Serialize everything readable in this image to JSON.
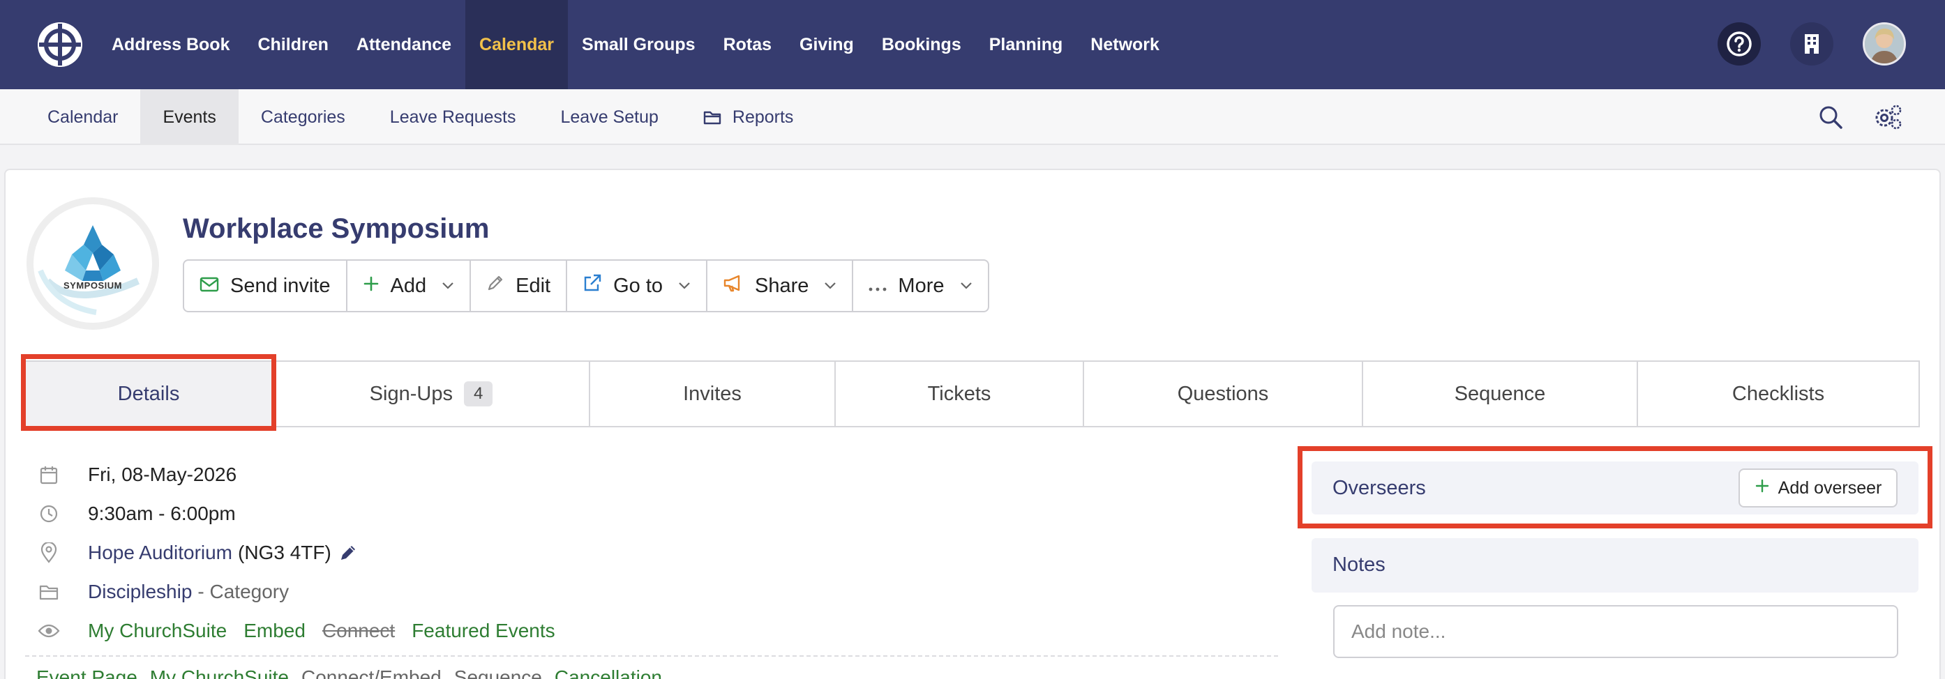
{
  "topnav": {
    "items": [
      {
        "label": "Address Book"
      },
      {
        "label": "Children"
      },
      {
        "label": "Attendance"
      },
      {
        "label": "Calendar",
        "active": true
      },
      {
        "label": "Small Groups"
      },
      {
        "label": "Rotas"
      },
      {
        "label": "Giving"
      },
      {
        "label": "Bookings"
      },
      {
        "label": "Planning"
      },
      {
        "label": "Network"
      }
    ],
    "icons": [
      "help-icon",
      "building-icon",
      "avatar"
    ]
  },
  "subnav": {
    "items": [
      {
        "label": "Calendar"
      },
      {
        "label": "Events",
        "active": true
      },
      {
        "label": "Categories"
      },
      {
        "label": "Leave Requests"
      },
      {
        "label": "Leave Setup"
      },
      {
        "label": "Reports",
        "icon": "folder-icon"
      }
    ],
    "icons": [
      "search-icon",
      "settings-icon"
    ]
  },
  "event": {
    "logo_text": "SYMPOSIUM",
    "title": "Workplace Symposium",
    "actions": [
      {
        "label": "Send invite",
        "icon": "envelope-icon"
      },
      {
        "label": "Add",
        "icon": "plus-icon",
        "dropdown": true
      },
      {
        "label": "Edit",
        "icon": "pencil-icon"
      },
      {
        "label": "Go to",
        "icon": "external-link-icon",
        "dropdown": true
      },
      {
        "label": "Share",
        "icon": "megaphone-icon",
        "dropdown": true
      },
      {
        "label": "More",
        "icon": "ellipsis-icon",
        "dropdown": true
      }
    ]
  },
  "tabs": [
    {
      "label": "Details",
      "active": true
    },
    {
      "label": "Sign-Ups",
      "count": "4"
    },
    {
      "label": "Invites"
    },
    {
      "label": "Tickets"
    },
    {
      "label": "Questions"
    },
    {
      "label": "Sequence"
    },
    {
      "label": "Checklists"
    }
  ],
  "details": {
    "date": "Fri, 08-May-2026",
    "time": "9:30am - 6:00pm",
    "location_name": "Hope Auditorium",
    "location_postcode": "(NG3 4TF)",
    "category_name": "Discipleship",
    "category_suffix": "- Category",
    "visibility": {
      "my_churchsuite": "My ChurchSuite",
      "embed": "Embed",
      "connect": "Connect",
      "featured": "Featured Events"
    },
    "bottom_links": [
      "Event Page",
      "My ChurchSuite",
      "Connect/Embed",
      "Sequence",
      "Cancellation"
    ]
  },
  "sidebar": {
    "overseers_title": "Overseers",
    "add_overseer_label": "Add overseer",
    "notes_title": "Notes",
    "note_placeholder": "Add note..."
  },
  "colors": {
    "brand_navy": "#363c6f",
    "active_nav": "#f2c14a",
    "highlight": "#e3402a",
    "link_green": "#2e7d32"
  }
}
